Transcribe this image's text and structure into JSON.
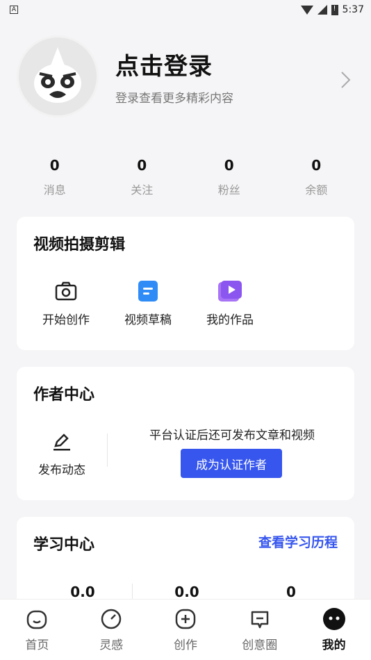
{
  "status_bar": {
    "time": "5:37",
    "left_badge": "A"
  },
  "profile": {
    "title": "点击登录",
    "subtitle": "登录查看更多精彩内容"
  },
  "stats": [
    {
      "value": "0",
      "label": "消息"
    },
    {
      "value": "0",
      "label": "关注"
    },
    {
      "value": "0",
      "label": "粉丝"
    },
    {
      "value": "0",
      "label": "余额"
    }
  ],
  "video_section": {
    "title": "视频拍摄剪辑",
    "items": [
      {
        "label": "开始创作",
        "icon": "camera-icon"
      },
      {
        "label": "视频草稿",
        "icon": "draft-icon"
      },
      {
        "label": "我的作品",
        "icon": "works-icon"
      }
    ]
  },
  "author_section": {
    "title": "作者中心",
    "post_label": "发布动态",
    "cert_text": "平台认证后还可发布文章和视频",
    "cert_button": "成为认证作者"
  },
  "study_section": {
    "title": "学习中心",
    "link": "查看学习历程",
    "values": [
      "0.0",
      "0.0",
      "0"
    ]
  },
  "bottom_nav": [
    {
      "label": "首页",
      "icon": "home-icon"
    },
    {
      "label": "灵感",
      "icon": "compass-icon"
    },
    {
      "label": "创作",
      "icon": "create-icon"
    },
    {
      "label": "创意圈",
      "icon": "chat-icon"
    },
    {
      "label": "我的",
      "icon": "profile-icon",
      "active": true
    }
  ],
  "colors": {
    "accent": "#3656ee"
  }
}
